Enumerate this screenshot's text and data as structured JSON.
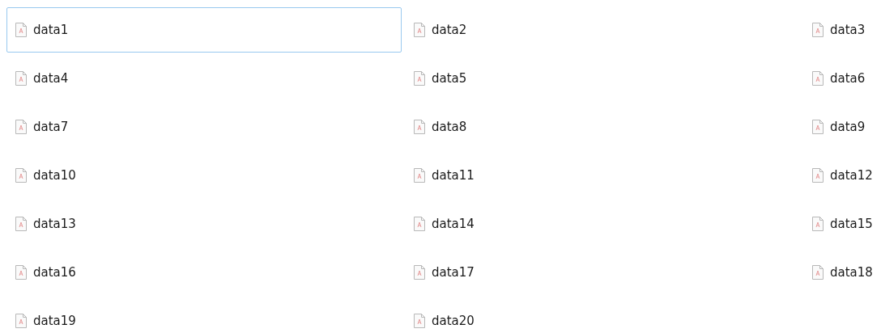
{
  "files": [
    {
      "name": "data1",
      "selected": true
    },
    {
      "name": "data2",
      "selected": false
    },
    {
      "name": "data3",
      "selected": false
    },
    {
      "name": "data4",
      "selected": false
    },
    {
      "name": "data5",
      "selected": false
    },
    {
      "name": "data6",
      "selected": false
    },
    {
      "name": "data7",
      "selected": false
    },
    {
      "name": "data8",
      "selected": false
    },
    {
      "name": "data9",
      "selected": false
    },
    {
      "name": "data10",
      "selected": false
    },
    {
      "name": "data11",
      "selected": false
    },
    {
      "name": "data12",
      "selected": false
    },
    {
      "name": "data13",
      "selected": false
    },
    {
      "name": "data14",
      "selected": false
    },
    {
      "name": "data15",
      "selected": false
    },
    {
      "name": "data16",
      "selected": false
    },
    {
      "name": "data17",
      "selected": false
    },
    {
      "name": "data18",
      "selected": false
    },
    {
      "name": "data19",
      "selected": false
    },
    {
      "name": "data20",
      "selected": false
    }
  ]
}
